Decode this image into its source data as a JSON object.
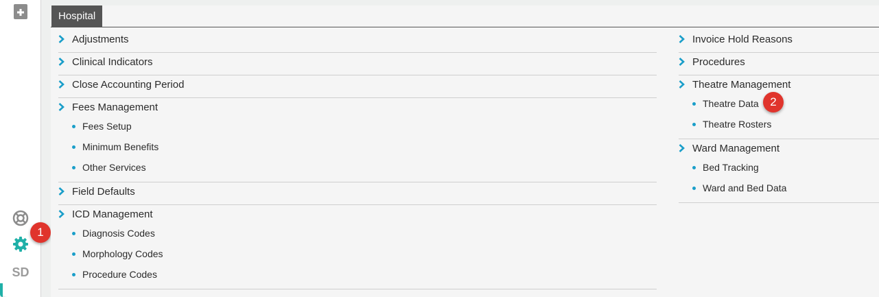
{
  "sidebar": {
    "user_initials": "SD",
    "icons": [
      "hospital-icon",
      "support-icon",
      "settings-icon"
    ],
    "accent_color": "#20b0a8"
  },
  "tab": {
    "label": "Hospital"
  },
  "left_column": [
    {
      "label": "Adjustments",
      "items": []
    },
    {
      "label": "Clinical Indicators",
      "items": []
    },
    {
      "label": "Close Accounting Period",
      "items": []
    },
    {
      "label": "Fees Management",
      "items": [
        "Fees Setup",
        "Minimum Benefits",
        "Other Services"
      ]
    },
    {
      "label": "Field Defaults",
      "items": []
    },
    {
      "label": "ICD Management",
      "items": [
        "Diagnosis Codes",
        "Morphology Codes",
        "Procedure Codes"
      ]
    }
  ],
  "right_column": [
    {
      "label": "Invoice Hold Reasons",
      "items": []
    },
    {
      "label": "Procedures",
      "items": []
    },
    {
      "label": "Theatre Management",
      "items": [
        "Theatre Data",
        "Theatre Rosters"
      ]
    },
    {
      "label": "Ward Management",
      "items": [
        "Bed Tracking",
        "Ward and Bed Data"
      ]
    }
  ],
  "callouts": [
    "1",
    "2"
  ],
  "colors": {
    "chevron": "#1a9ec9",
    "badge": "#e0342c",
    "tab_bg": "#555555"
  }
}
